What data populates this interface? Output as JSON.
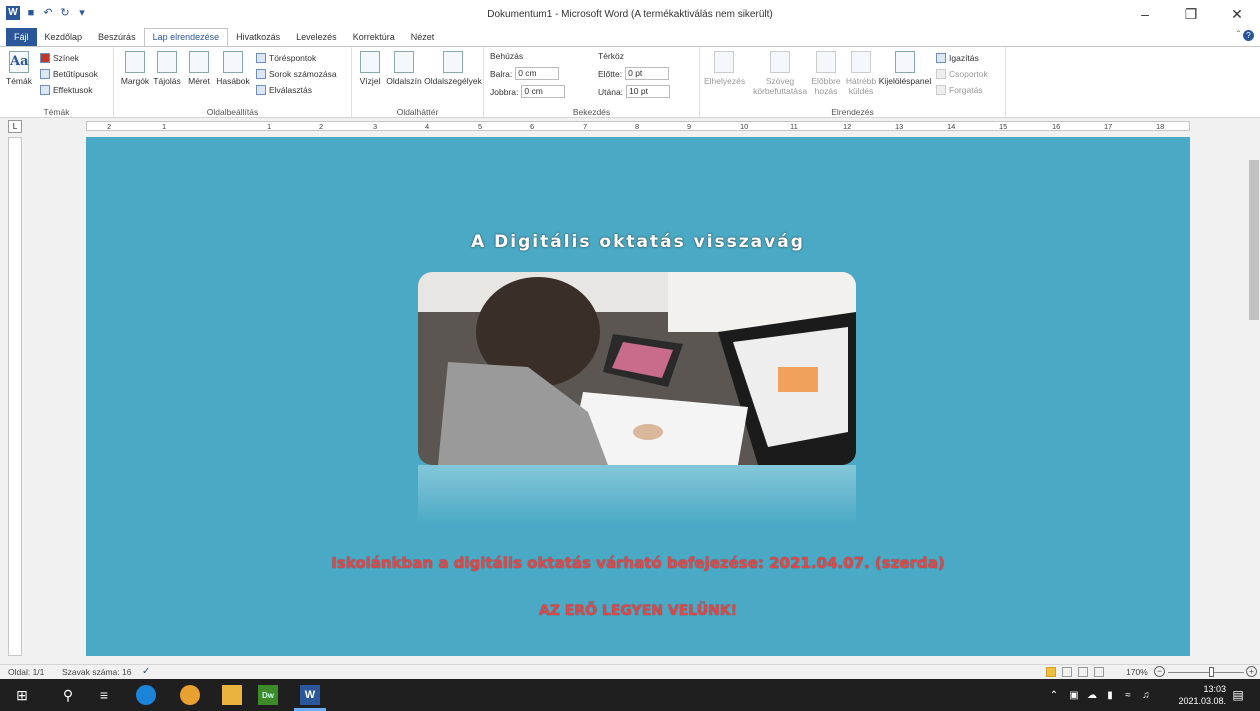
{
  "window": {
    "title": "Dokumentum1 - Microsoft Word (A termékaktiválás nem sikerült)"
  },
  "tabs": [
    {
      "label": "Fájl"
    },
    {
      "label": "Kezdőlap"
    },
    {
      "label": "Beszúrás"
    },
    {
      "label": "Lap elrendezése"
    },
    {
      "label": "Hivatkozás"
    },
    {
      "label": "Levelezés"
    },
    {
      "label": "Korrektúra"
    },
    {
      "label": "Nézet"
    }
  ],
  "ribbon": {
    "temak": {
      "label": "Témák",
      "btn": "Témák",
      "szinek": "Színek",
      "betutipusok": "Betűtípusok",
      "effektusok": "Effektusok"
    },
    "oldalbeallitas": {
      "label": "Oldalbeállítás",
      "margok": "Margók",
      "tajolas": "Tájolás",
      "meret": "Méret",
      "hasabok": "Hasábok",
      "torespontok": "Töréspontok",
      "sorok": "Sorok számozása",
      "elvalasztas": "Elválasztás"
    },
    "oldalhatter": {
      "label": "Oldalháttér",
      "vizjel": "Vízjel",
      "oldalszin": "Oldalszín",
      "oldalszegelyek": "Oldalszegélyek"
    },
    "bekezdes": {
      "label": "Bekezdés",
      "behuzas": "Behúzás",
      "balra": "Balra:",
      "balra_val": "0 cm",
      "jobbra": "Jobbra:",
      "jobbra_val": "0 cm",
      "terkoz": "Térköz",
      "elotte": "Előtte:",
      "elotte_val": "0 pt",
      "utana": "Utána:",
      "utana_val": "10 pt"
    },
    "elrendezes": {
      "label": "Elrendezés",
      "elhelyezes": "Elhelyezés",
      "szoveg": "Szöveg",
      "korbefuttatasa": "körbefuttatása",
      "elobbre": "Előbbre",
      "hozas": "hozás",
      "hatrebb": "Hátrébb",
      "kuldes": "küldés",
      "kijelolespanel": "Kijelöléspanel",
      "igazitas": "Igazítás",
      "csoportok": "Csoportok",
      "forgatas": "Forgatás"
    }
  },
  "ruler": {
    "ticks": [
      "2",
      "1",
      "1",
      "2",
      "3",
      "4",
      "5",
      "6",
      "7",
      "8",
      "9",
      "10",
      "11",
      "12",
      "13",
      "14",
      "15",
      "16",
      "17",
      "18"
    ]
  },
  "document": {
    "heading": "A Digitális oktatás visszavág",
    "line1": "Iskolánkban a digitális oktatás várható befejezése: 2021.04.07. (szerda)",
    "line2": "AZ ERŐ LEGYEN VELÜNK!"
  },
  "status": {
    "page": "Oldal: 1/1",
    "words": "Szavak száma: 16",
    "zoom": "170%"
  },
  "taskbar": {
    "time": "13:03",
    "date": "2021.03.08."
  },
  "colors": {
    "accent": "#2b579a",
    "page_bg": "#4aa9c4",
    "red_text": "#e04848"
  }
}
